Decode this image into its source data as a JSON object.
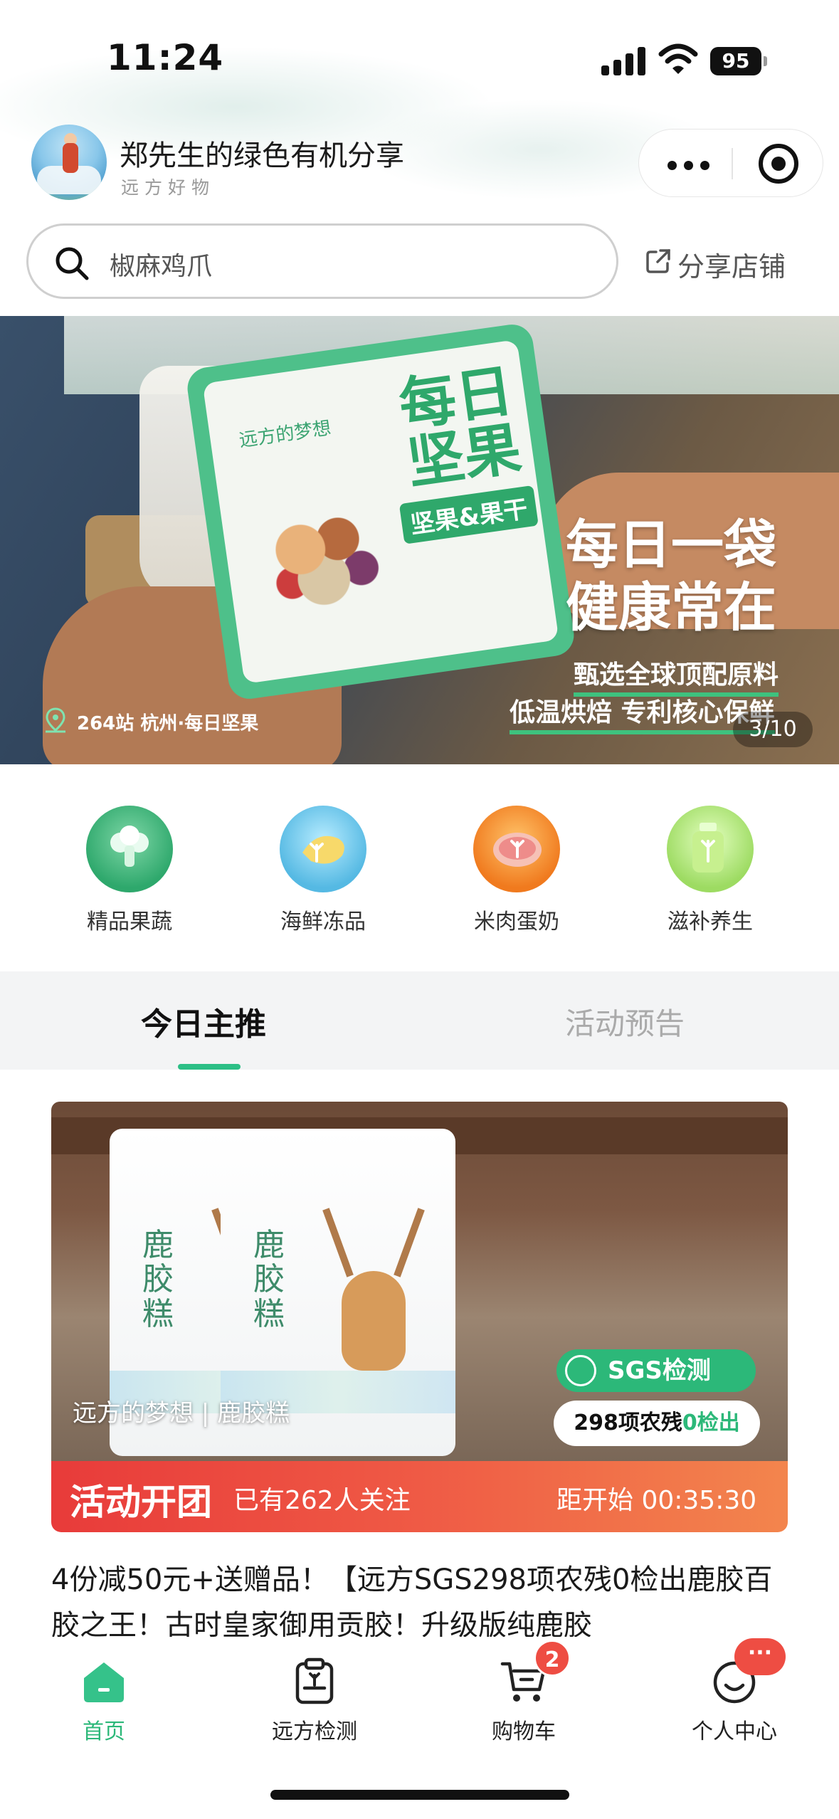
{
  "status_bar": {
    "time": "11:24",
    "battery": "95"
  },
  "shop": {
    "name": "郑先生的绿色有机分享",
    "subtitle": "远方好物"
  },
  "search": {
    "placeholder": "椒麻鸡爪",
    "share_label": "分享店铺"
  },
  "banner": {
    "bag_brand": "远方的梦想",
    "bag_title_line1": "每日",
    "bag_title_line2": "坚果",
    "bag_tag": "坚果&果干",
    "headline_line1": "每日一袋",
    "headline_line2": "健康常在",
    "line1": "甄选全球顶配原料",
    "line2": "低温烘焙 专利核心保鲜",
    "location": "264站  杭州·每日坚果",
    "page_indicator": "3/10"
  },
  "categories": [
    {
      "label": "精品果蔬",
      "icon": "broccoli-icon",
      "color": "#3fb27a"
    },
    {
      "label": "海鲜冻品",
      "icon": "fish-icon",
      "color": "#6ec6e8"
    },
    {
      "label": "米肉蛋奶",
      "icon": "meat-icon",
      "color": "#f28c2a"
    },
    {
      "label": "滋补养生",
      "icon": "bottle-icon",
      "color": "#a8df6e"
    }
  ],
  "tabs": {
    "active": "今日主推",
    "inactive": "活动预告"
  },
  "product": {
    "pouch_title": "鹿胶糕",
    "image_caption": "远方的梦想 | 鹿胶糕",
    "sgs_label": "SGS检测",
    "sgs_detail_prefix": "298项农残",
    "sgs_detail_highlight": "0检出",
    "promo_title": "活动开团",
    "promo_followers": "已有262人关注",
    "promo_countdown": "距开始 00:35:30",
    "description": "4份减50元+送赠品！【远方SGS298项农残0检出鹿胶百胶之王！古时皇家御用贡胶！升级版纯鹿胶"
  },
  "bottom_nav": {
    "items": [
      {
        "label": "首页",
        "icon": "home-icon",
        "active": true
      },
      {
        "label": "远方检测",
        "icon": "clipboard-icon",
        "active": false
      },
      {
        "label": "购物车",
        "icon": "cart-icon",
        "active": false
      },
      {
        "label": "个人中心",
        "icon": "profile-icon",
        "active": false
      }
    ],
    "cart_badge": "2",
    "profile_badge": "···"
  },
  "colors": {
    "accent": "#2cb879",
    "promo_red": "#e83b3a",
    "badge_red": "#ee4d43"
  }
}
